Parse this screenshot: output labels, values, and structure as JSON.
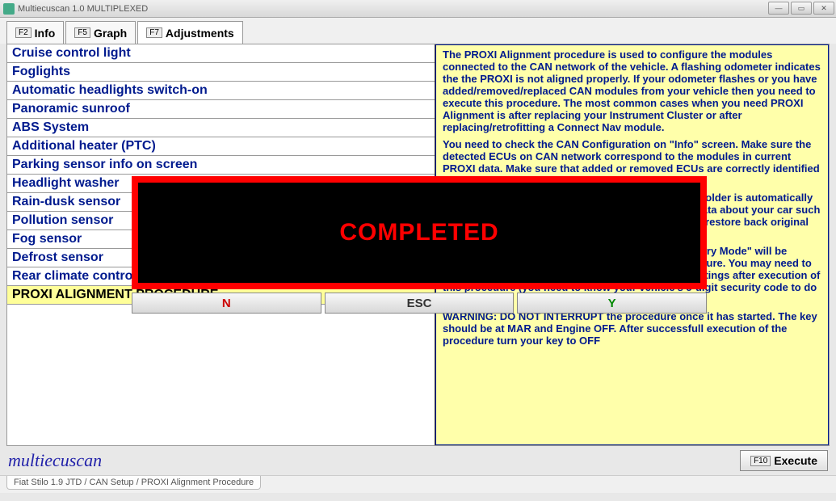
{
  "window": {
    "title": "Multiecuscan 1.0 MULTIPLEXED"
  },
  "tabs": [
    {
      "key": "F2",
      "label": "Info"
    },
    {
      "key": "F5",
      "label": "Graph"
    },
    {
      "key": "F7",
      "label": "Adjustments"
    }
  ],
  "active_tab": 2,
  "adjustments_list": [
    "Cruise control light",
    "Foglights",
    "Automatic headlights switch-on",
    "Panoramic sunroof",
    "ABS System",
    "Additional heater (PTC)",
    "Parking sensor info on screen",
    "Headlight washer",
    "Rain-dusk sensor",
    "Pollution sensor",
    "Fog sensor",
    "Defrost sensor",
    "Rear climate control",
    "PROXI ALIGNMENT PROCEDURE"
  ],
  "selected_index": 13,
  "description": {
    "p1": "The PROXI Alignment procedure is used to configure the modules connected to the CAN network of the vehicle. A flashing odometer indicates the the PROXI is not aligned properly. If your odometer flashes or you have added/removed/replaced CAN modules from your vehicle then you need to execute this procedure. The most common cases when you need PROXI Alignment is after replacing your Instrument Cluster or after replacing/retrofitting a Connect Nav module.",
    "p2": "You need to check the CAN Configuration on \"Info\" screen. Make sure the detected ECUs on CAN network correspond to the modules in current PROXI data. Make sure that added or removed ECUs are correctly identified and old ECUs are properly configured.",
    "p3": "A backup of the original PROXI data in the modules folder is automatically created. The PROXI data contains some important data about your car such as mileage, CAN configuration and you may need to restore back original settings in case of problems.",
    "p4": "NOTE: The \"Indicators Command\" and \"Alarm Country Mode\" will be restored to the factory default value after this procedure. You may need to connect to the Body Computer and correct these settings after execution of this procedure (you need to know your vehicle's 5-digit security code to do that).",
    "p5": "WARNING: DO NOT INTERRUPT the procedure once it has started. The key should be at MAR and Engine OFF. After successfull execution of the procedure turn your key to OFF"
  },
  "modal": {
    "message": "COMPLETED",
    "btn_n": "N",
    "btn_esc": "ESC",
    "btn_y": "Y"
  },
  "footer": {
    "brand": "multiecuscan",
    "execute_key": "F10",
    "execute_label": "Execute"
  },
  "statusbar": "Fiat Stilo 1.9 JTD / CAN Setup / PROXI Alignment Procedure"
}
